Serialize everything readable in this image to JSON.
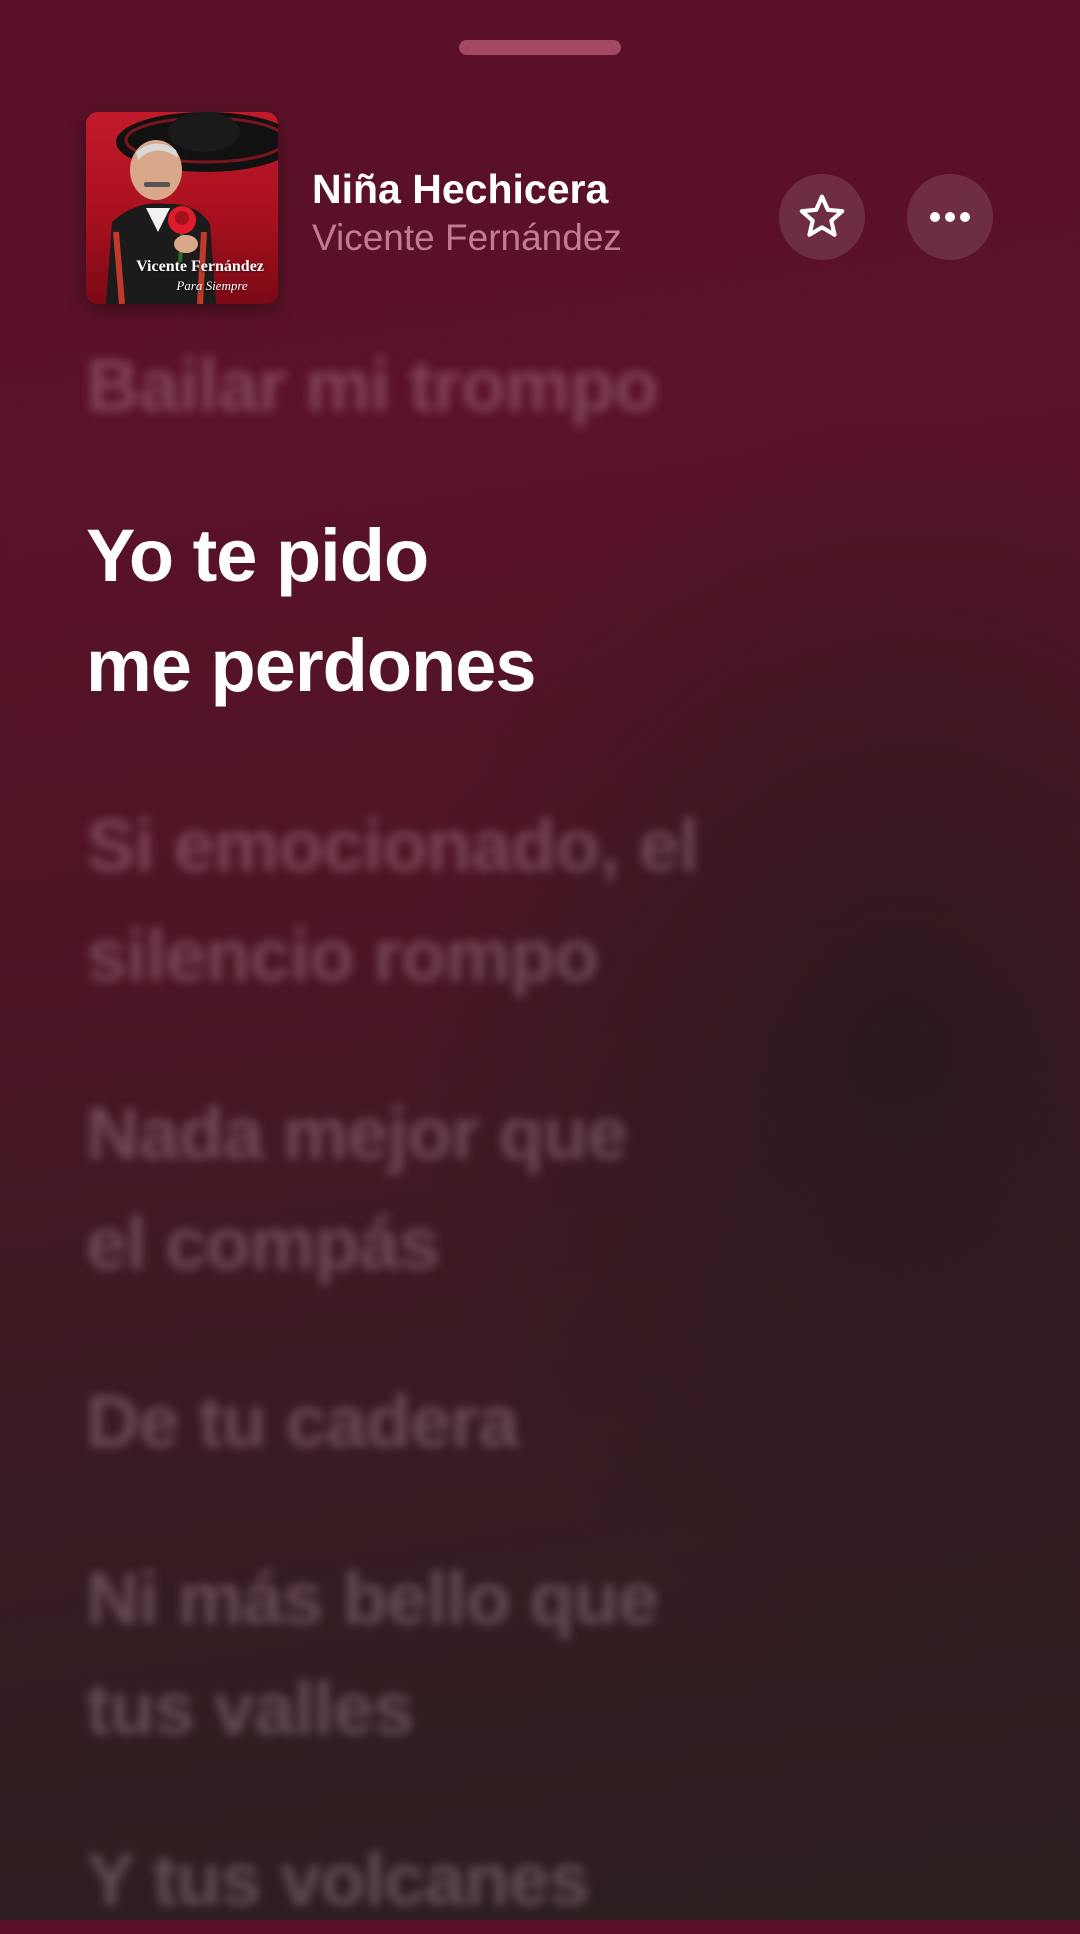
{
  "now_playing": {
    "title": "Niña Hechicera",
    "artist": "Vicente Fernández",
    "artwork": {
      "artist_text": "Vicente Fernández",
      "album_text": "Para Siempre",
      "accent_color": "#b5121f"
    }
  },
  "actions": {
    "favorite_icon": "star-icon",
    "more_icon": "ellipsis-icon"
  },
  "lyrics": {
    "lines": [
      {
        "text": "Bailar mi trompo",
        "state": "past"
      },
      {
        "text": "Yo te pido",
        "state": "current"
      },
      {
        "text": "me perdones",
        "state": "current"
      },
      {
        "text": "Si emocionado, el",
        "state": "upcoming"
      },
      {
        "text": "silencio rompo",
        "state": "upcoming"
      },
      {
        "text": "Nada mejor que",
        "state": "upcoming"
      },
      {
        "text": "el compás",
        "state": "upcoming"
      },
      {
        "text": "De tu cadera",
        "state": "upcoming"
      },
      {
        "text": "Ni más bello que",
        "state": "upcoming"
      },
      {
        "text": "tus valles",
        "state": "upcoming"
      },
      {
        "text": "Y tus volcanes",
        "state": "upcoming"
      }
    ]
  },
  "colors": {
    "background_top": "#5a1028",
    "background_bottom": "#2a1e1f",
    "active_lyric": "#ffffff"
  }
}
